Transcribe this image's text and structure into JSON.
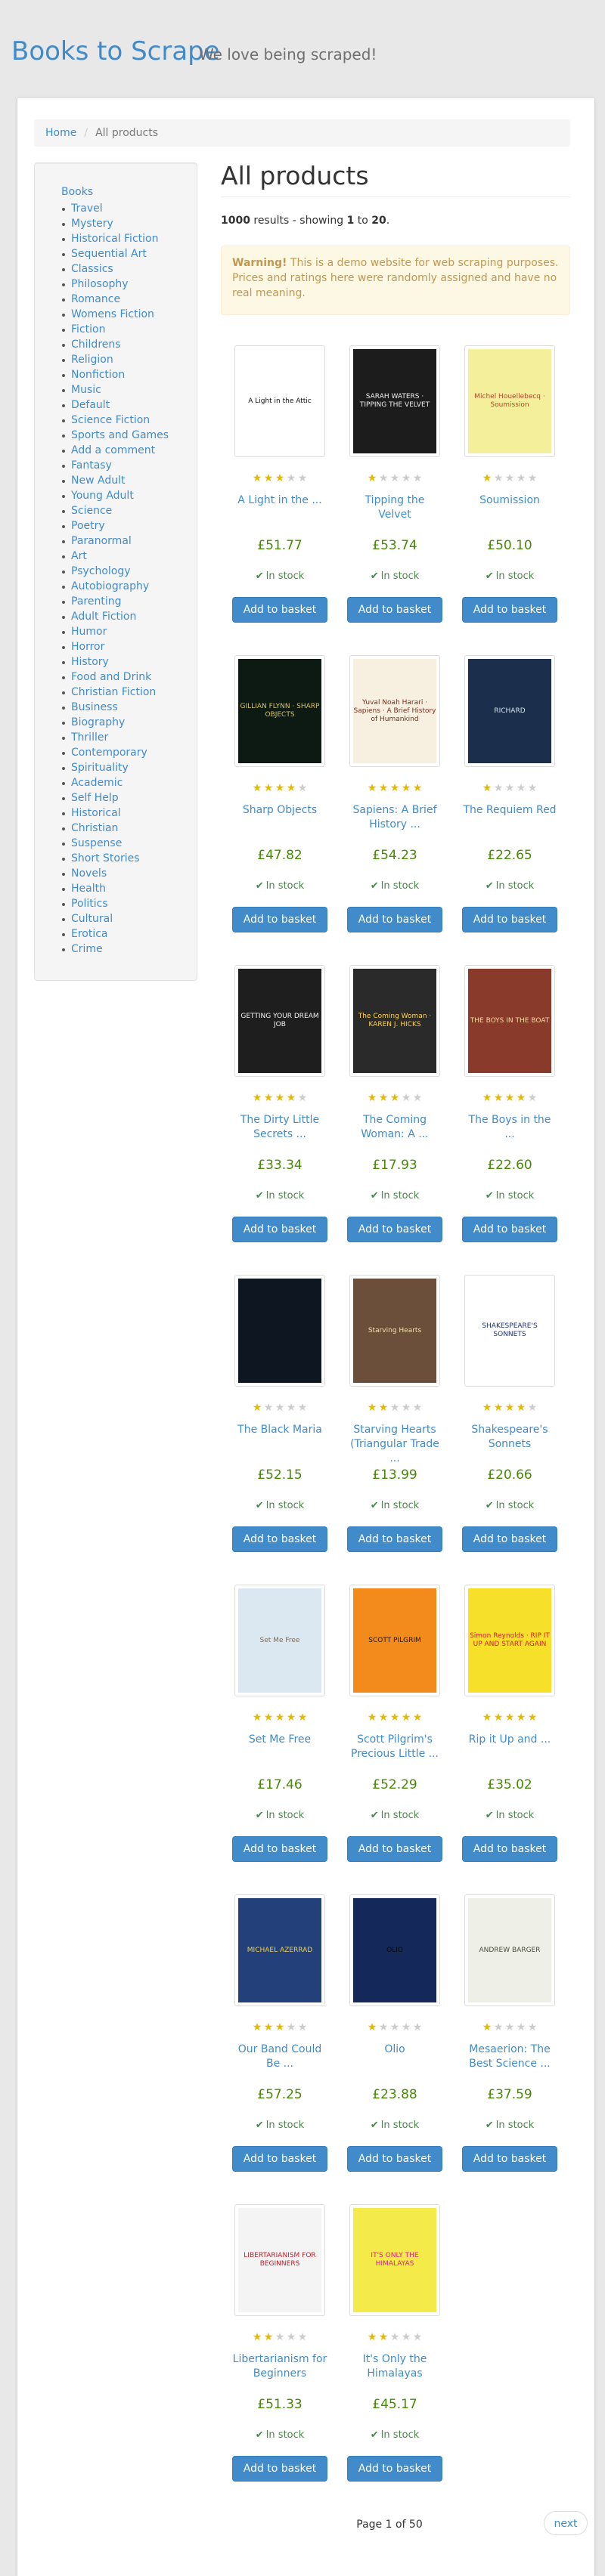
{
  "header": {
    "brand": "Books to Scrape",
    "tagline": "We love being scraped!"
  },
  "breadcrumb": {
    "home": "Home",
    "separator": "/",
    "current": "All products"
  },
  "sidebar": {
    "root": "Books",
    "categories": [
      "Travel",
      "Mystery",
      "Historical Fiction",
      "Sequential Art",
      "Classics",
      "Philosophy",
      "Romance",
      "Womens Fiction",
      "Fiction",
      "Childrens",
      "Religion",
      "Nonfiction",
      "Music",
      "Default",
      "Science Fiction",
      "Sports and Games",
      "Add a comment",
      "Fantasy",
      "New Adult",
      "Young Adult",
      "Science",
      "Poetry",
      "Paranormal",
      "Art",
      "Psychology",
      "Autobiography",
      "Parenting",
      "Adult Fiction",
      "Humor",
      "Horror",
      "History",
      "Food and Drink",
      "Christian Fiction",
      "Business",
      "Biography",
      "Thriller",
      "Contemporary",
      "Spirituality",
      "Academic",
      "Self Help",
      "Historical",
      "Christian",
      "Suspense",
      "Short Stories",
      "Novels",
      "Health",
      "Politics",
      "Cultural",
      "Erotica",
      "Crime"
    ]
  },
  "main": {
    "title": "All products",
    "results": {
      "count": "1000",
      "middle": " results - showing ",
      "from": "1",
      "to_word": " to ",
      "to": "20",
      "end": "."
    },
    "alert": {
      "strong": "Warning!",
      "text": " This is a demo website for web scraping purposes. Prices and ratings here were randomly assigned and have no real meaning."
    }
  },
  "labels": {
    "in_stock": "In stock",
    "add_to_basket": "Add to basket"
  },
  "icons": {
    "star": "star-icon",
    "check": "check-icon"
  },
  "colors": {
    "link": "#428bca",
    "price": "#458B00",
    "stock": "#468847",
    "star_on": "#e6b800",
    "star_off": "#cccccc",
    "alert_bg": "#fcf8e3",
    "alert_text": "#c09853"
  },
  "books": [
    {
      "title": "A Light in the ...",
      "price": "£51.77",
      "rating": 3,
      "cover_text": "A Light in the Attic",
      "cover_bg": "#ffffff",
      "cover_fg": "#111111"
    },
    {
      "title": "Tipping the Velvet",
      "price": "£53.74",
      "rating": 1,
      "cover_text": "SARAH WATERS · TIPPING THE VELVET",
      "cover_bg": "#1c1c1c",
      "cover_fg": "#f0f0f0"
    },
    {
      "title": "Soumission",
      "price": "£50.10",
      "rating": 1,
      "cover_text": "Michel Houellebecq · Soumission",
      "cover_bg": "#f3ef9a",
      "cover_fg": "#b34a2a"
    },
    {
      "title": "Sharp Objects",
      "price": "£47.82",
      "rating": 4,
      "cover_text": "GILLIAN FLYNN · SHARP OBJECTS",
      "cover_bg": "#0d1a14",
      "cover_fg": "#d9c35a"
    },
    {
      "title": "Sapiens: A Brief History ...",
      "price": "£54.23",
      "rating": 5,
      "cover_text": "Yuval Noah Harari · Sapiens · A Brief History of Humankind",
      "cover_bg": "#f7f0e1",
      "cover_fg": "#7a2d1a"
    },
    {
      "title": "The Requiem Red",
      "price": "£22.65",
      "rating": 1,
      "cover_text": "RICHARD",
      "cover_bg": "#1b2f4d",
      "cover_fg": "#d6e2f0"
    },
    {
      "title": "The Dirty Little Secrets ...",
      "price": "£33.34",
      "rating": 4,
      "cover_text": "GETTING YOUR DREAM JOB",
      "cover_bg": "#1e1e1e",
      "cover_fg": "#f2f2f2"
    },
    {
      "title": "The Coming Woman: A ...",
      "price": "£17.93",
      "rating": 3,
      "cover_text": "The Coming Woman · KAREN J. HICKS",
      "cover_bg": "#2a2a2a",
      "cover_fg": "#ffd34d"
    },
    {
      "title": "The Boys in the ...",
      "price": "£22.60",
      "rating": 4,
      "cover_text": "THE BOYS IN THE BOAT",
      "cover_bg": "#8a3a2a",
      "cover_fg": "#f4d9a0"
    },
    {
      "title": "The Black Maria",
      "price": "£52.15",
      "rating": 1,
      "cover_text": "",
      "cover_bg": "#0e1621",
      "cover_fg": "#8aa3bf"
    },
    {
      "title": "Starving Hearts (Triangular Trade ...",
      "price": "£13.99",
      "rating": 2,
      "cover_text": "Starving Hearts",
      "cover_bg": "#6b4f3a",
      "cover_fg": "#f3e0b0"
    },
    {
      "title": "Shakespeare's Sonnets",
      "price": "£20.66",
      "rating": 4,
      "cover_text": "SHAKESPEARE'S SONNETS",
      "cover_bg": "#ffffff",
      "cover_fg": "#1f2f7a"
    },
    {
      "title": "Set Me Free",
      "price": "£17.46",
      "rating": 5,
      "cover_text": "Set Me Free",
      "cover_bg": "#dbe8f2",
      "cover_fg": "#7a6a55"
    },
    {
      "title": "Scott Pilgrim's Precious Little ...",
      "price": "£52.29",
      "rating": 5,
      "cover_text": "SCOTT PILGRIM",
      "cover_bg": "#f28a1c",
      "cover_fg": "#1a1a1a"
    },
    {
      "title": "Rip it Up and ...",
      "price": "£35.02",
      "rating": 5,
      "cover_text": "Simon Reynolds · RIP IT UP AND START AGAIN",
      "cover_bg": "#f6e02a",
      "cover_fg": "#d8202a"
    },
    {
      "title": "Our Band Could Be ...",
      "price": "£57.25",
      "rating": 3,
      "cover_text": "MICHAEL AZERRAD",
      "cover_bg": "#23407a",
      "cover_fg": "#f2d24a"
    },
    {
      "title": "Olio",
      "price": "£23.88",
      "rating": 1,
      "cover_text": "OLIO",
      "cover_bg": "#14285a",
      "cover_fg": "#0a0a0a"
    },
    {
      "title": "Mesaerion: The Best Science ...",
      "price": "£37.59",
      "rating": 1,
      "cover_text": "ANDREW BARGER",
      "cover_bg": "#eef0e8",
      "cover_fg": "#4a4a3a"
    },
    {
      "title": "Libertarianism for Beginners",
      "price": "£51.33",
      "rating": 2,
      "cover_text": "LIBERTARIANISM FOR BEGINNERS",
      "cover_bg": "#f4f4f4",
      "cover_fg": "#c0202a"
    },
    {
      "title": "It's Only the Himalayas",
      "price": "£45.17",
      "rating": 2,
      "cover_text": "IT'S ONLY THE HIMALAYAS",
      "cover_bg": "#f4ea4a",
      "cover_fg": "#e0208a"
    }
  ],
  "pager": {
    "current": "Page 1 of 50",
    "next": "next"
  }
}
